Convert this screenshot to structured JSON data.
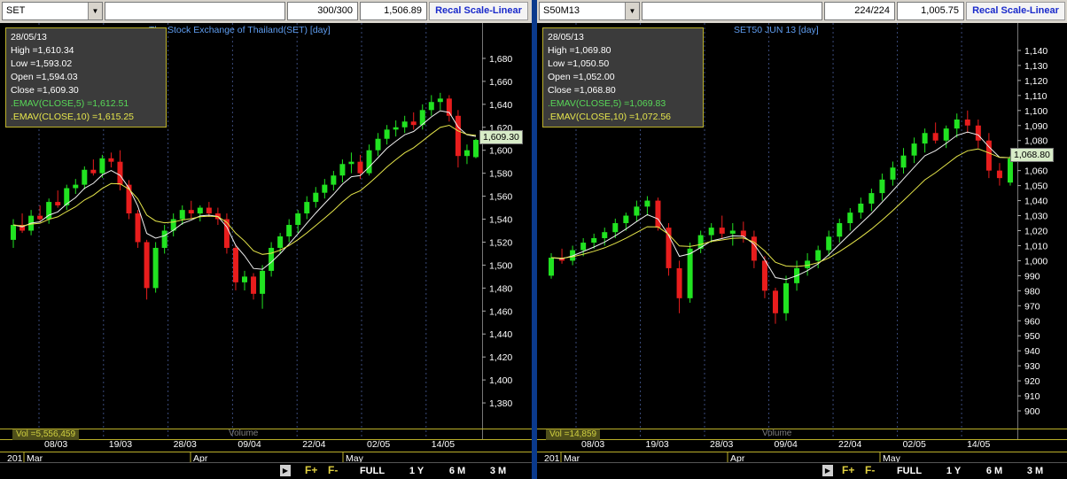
{
  "panes": [
    {
      "id": "left",
      "symbol": "SET",
      "count": "300/300",
      "last_value": "1,506.89",
      "recal_label": "Recal Scale-Linear",
      "title": "The Stock Exchange of Thailand(SET) [day]",
      "info": {
        "date": "28/05/13",
        "high": "High  =1,610.34",
        "low": "Low  =1,593.02",
        "open": "Open  =1,594.03",
        "close": "Close  =1,609.30",
        "ema5": ".EMAV(CLOSE,5)   =1,612.51",
        "ema10": ".EMAV(CLOSE,10)   =1,615.25"
      },
      "last_price_label": "1,609.30",
      "vol_label": "Vol  =5,556,459",
      "vol_title": "Volume",
      "date_labels": [
        "08/03",
        "19/03",
        "28/03",
        "09/04",
        "22/04",
        "02/05",
        "14/05"
      ],
      "month_labels": [
        "201",
        "Mar",
        "Apr",
        "May"
      ],
      "y_labels": [
        "1,680",
        "1,660",
        "1,640",
        "1,620",
        "1,600",
        "1,580",
        "1,560",
        "1,540",
        "1,520",
        "1,500",
        "1,480",
        "1,460",
        "1,440",
        "1,420",
        "1,400",
        "1,380"
      ],
      "bottom": {
        "play": "▶",
        "fplus": "F+",
        "fminus": "F-",
        "full": "FULL",
        "y1": "1 Y",
        "m6": "6 M",
        "m3": "3 M"
      }
    },
    {
      "id": "right",
      "symbol": "S50M13",
      "count": "224/224",
      "last_value": "1,005.75",
      "recal_label": "Recal Scale-Linear",
      "title": "SET50 JUN 13  [day]",
      "info": {
        "date": "28/05/13",
        "high": "High  =1,069.80",
        "low": "Low  =1,050.50",
        "open": "Open  =1,052.00",
        "close": "Close  =1,068.80",
        "ema5": ".EMAV(CLOSE,5)   =1,069.83",
        "ema10": ".EMAV(CLOSE,10)   =1,072.56"
      },
      "last_price_label": "1,068.80",
      "vol_label": "Vol  =14,859",
      "vol_title": "Volume",
      "date_labels": [
        "08/03",
        "19/03",
        "28/03",
        "09/04",
        "22/04",
        "02/05",
        "14/05"
      ],
      "month_labels": [
        "201",
        "Mar",
        "Apr",
        "May"
      ],
      "y_labels": [
        "1,140",
        "1,130",
        "1,120",
        "1,110",
        "1,100",
        "1,090",
        "1,080",
        "1,070",
        "1,060",
        "1,050",
        "1,040",
        "1,030",
        "1,020",
        "1,010",
        "1,000",
        "990",
        "980",
        "970",
        "960",
        "950",
        "940",
        "930",
        "920",
        "910",
        "900"
      ],
      "bottom": {
        "play": "▶",
        "fplus": "F+",
        "fminus": "F-",
        "full": "FULL",
        "y1": "1 Y",
        "m6": "6 M",
        "m3": "3 M"
      }
    }
  ],
  "chart_data": [
    {
      "type": "candlestick",
      "title": "The Stock Exchange of Thailand(SET) [day]",
      "ylim": [
        1360,
        1700
      ],
      "x": [
        "08/03",
        "19/03",
        "28/03",
        "09/04",
        "22/04",
        "02/05",
        "14/05"
      ],
      "candles": [
        [
          1522,
          1540,
          1515,
          1535
        ],
        [
          1535,
          1545,
          1528,
          1530
        ],
        [
          1530,
          1548,
          1526,
          1543
        ],
        [
          1543,
          1552,
          1538,
          1540
        ],
        [
          1540,
          1558,
          1536,
          1555
        ],
        [
          1555,
          1565,
          1550,
          1552
        ],
        [
          1552,
          1570,
          1548,
          1567
        ],
        [
          1567,
          1575,
          1562,
          1570
        ],
        [
          1570,
          1586,
          1566,
          1583
        ],
        [
          1583,
          1592,
          1578,
          1580
        ],
        [
          1580,
          1596,
          1576,
          1593
        ],
        [
          1593,
          1598,
          1585,
          1590
        ],
        [
          1590,
          1600,
          1565,
          1570
        ],
        [
          1570,
          1574,
          1540,
          1545
        ],
        [
          1545,
          1548,
          1515,
          1520
        ],
        [
          1520,
          1522,
          1470,
          1480
        ],
        [
          1480,
          1520,
          1476,
          1515
        ],
        [
          1515,
          1535,
          1510,
          1530
        ],
        [
          1530,
          1545,
          1525,
          1540
        ],
        [
          1540,
          1552,
          1535,
          1548
        ],
        [
          1548,
          1556,
          1540,
          1545
        ],
        [
          1545,
          1552,
          1538,
          1550
        ],
        [
          1550,
          1555,
          1542,
          1545
        ],
        [
          1545,
          1550,
          1535,
          1540
        ],
        [
          1540,
          1545,
          1510,
          1515
        ],
        [
          1515,
          1518,
          1478,
          1485
        ],
        [
          1485,
          1495,
          1478,
          1490
        ],
        [
          1490,
          1493,
          1470,
          1475
        ],
        [
          1475,
          1500,
          1462,
          1495
        ],
        [
          1495,
          1520,
          1490,
          1515
        ],
        [
          1515,
          1528,
          1510,
          1525
        ],
        [
          1525,
          1540,
          1520,
          1535
        ],
        [
          1535,
          1548,
          1528,
          1545
        ],
        [
          1545,
          1560,
          1540,
          1555
        ],
        [
          1555,
          1568,
          1550,
          1563
        ],
        [
          1563,
          1575,
          1558,
          1570
        ],
        [
          1570,
          1582,
          1565,
          1578
        ],
        [
          1578,
          1592,
          1572,
          1588
        ],
        [
          1588,
          1598,
          1580,
          1590
        ],
        [
          1590,
          1596,
          1575,
          1580
        ],
        [
          1580,
          1605,
          1578,
          1600
        ],
        [
          1600,
          1615,
          1595,
          1610
        ],
        [
          1610,
          1622,
          1605,
          1618
        ],
        [
          1618,
          1626,
          1612,
          1620
        ],
        [
          1620,
          1630,
          1615,
          1625
        ],
        [
          1625,
          1633,
          1618,
          1622
        ],
        [
          1622,
          1640,
          1618,
          1635
        ],
        [
          1635,
          1648,
          1630,
          1642
        ],
        [
          1642,
          1650,
          1635,
          1645
        ],
        [
          1645,
          1648,
          1625,
          1630
        ],
        [
          1630,
          1635,
          1585,
          1595
        ],
        [
          1595,
          1605,
          1588,
          1600
        ],
        [
          1594,
          1610,
          1593,
          1609
        ]
      ]
    },
    {
      "type": "candlestick",
      "title": "SET50 JUN 13  [day]",
      "ylim": [
        890,
        1150
      ],
      "x": [
        "08/03",
        "19/03",
        "28/03",
        "09/04",
        "22/04",
        "02/05",
        "14/05"
      ],
      "candles": [
        [
          990,
          1005,
          988,
          1002
        ],
        [
          1002,
          1008,
          998,
          1000
        ],
        [
          1000,
          1010,
          997,
          1007
        ],
        [
          1007,
          1015,
          1003,
          1012
        ],
        [
          1012,
          1018,
          1008,
          1015
        ],
        [
          1015,
          1022,
          1010,
          1019
        ],
        [
          1019,
          1028,
          1015,
          1025
        ],
        [
          1025,
          1032,
          1020,
          1030
        ],
        [
          1030,
          1040,
          1026,
          1036
        ],
        [
          1036,
          1043,
          1030,
          1040
        ],
        [
          1040,
          1042,
          1020,
          1022
        ],
        [
          1022,
          1025,
          990,
          995
        ],
        [
          995,
          1000,
          965,
          975
        ],
        [
          975,
          1012,
          972,
          1008
        ],
        [
          1008,
          1020,
          1005,
          1017
        ],
        [
          1017,
          1025,
          1012,
          1022
        ],
        [
          1022,
          1030,
          1015,
          1018
        ],
        [
          1018,
          1025,
          1010,
          1020
        ],
        [
          1020,
          1026,
          1012,
          1016
        ],
        [
          1016,
          1020,
          995,
          1000
        ],
        [
          1000,
          1003,
          975,
          980
        ],
        [
          980,
          982,
          958,
          965
        ],
        [
          965,
          990,
          960,
          985
        ],
        [
          985,
          1000,
          980,
          995
        ],
        [
          995,
          1005,
          990,
          1000
        ],
        [
          1000,
          1010,
          995,
          1007
        ],
        [
          1007,
          1020,
          1003,
          1016
        ],
        [
          1016,
          1028,
          1012,
          1025
        ],
        [
          1025,
          1035,
          1020,
          1032
        ],
        [
          1032,
          1042,
          1028,
          1038
        ],
        [
          1038,
          1048,
          1033,
          1045
        ],
        [
          1045,
          1058,
          1040,
          1054
        ],
        [
          1054,
          1066,
          1050,
          1062
        ],
        [
          1062,
          1075,
          1058,
          1070
        ],
        [
          1070,
          1082,
          1065,
          1078
        ],
        [
          1078,
          1088,
          1072,
          1085
        ],
        [
          1085,
          1092,
          1078,
          1080
        ],
        [
          1080,
          1090,
          1075,
          1088
        ],
        [
          1088,
          1098,
          1082,
          1094
        ],
        [
          1094,
          1100,
          1085,
          1090
        ],
        [
          1090,
          1094,
          1075,
          1080
        ],
        [
          1080,
          1085,
          1055,
          1060
        ],
        [
          1060,
          1065,
          1050,
          1055
        ],
        [
          1052,
          1070,
          1050,
          1068
        ]
      ]
    }
  ]
}
